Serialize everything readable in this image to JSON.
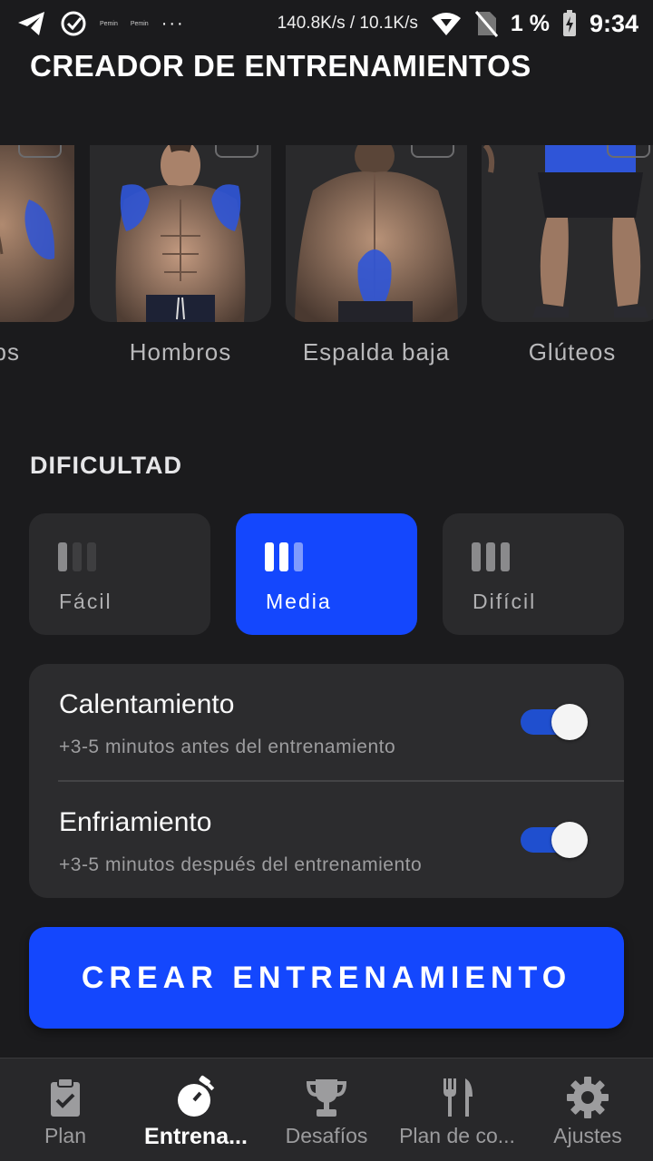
{
  "status_bar": {
    "small_labels": [
      "Pemin",
      "Pemin"
    ],
    "dots": "···",
    "network_speed": "140.8K/s / 10.1K/s",
    "battery": "1 %",
    "time": "9:34"
  },
  "title": "CREADOR DE ENTRENAMIENTOS",
  "muscles": [
    {
      "label": "ps"
    },
    {
      "label": "Hombros"
    },
    {
      "label": "Espalda baja"
    },
    {
      "label": "Glúteos"
    }
  ],
  "difficulty": {
    "title": "DIFICULTAD",
    "options": [
      {
        "label": "Fácil",
        "level": 1,
        "selected": false
      },
      {
        "label": "Media",
        "level": 2,
        "selected": true
      },
      {
        "label": "Difícil",
        "level": 3,
        "selected": false
      }
    ]
  },
  "options": [
    {
      "title": "Calentamiento",
      "subtitle": "+3-5 minutos antes del entrenamiento",
      "enabled": true
    },
    {
      "title": "Enfriamiento",
      "subtitle": "+3-5 minutos después del entrenamiento",
      "enabled": true
    }
  ],
  "create_button": "CREAR ENTRENAMIENTO",
  "nav": {
    "items": [
      {
        "label": "Plan",
        "icon": "clipboard-icon",
        "active": false
      },
      {
        "label": "Entrena...",
        "icon": "stopwatch-icon",
        "active": true
      },
      {
        "label": "Desafíos",
        "icon": "trophy-icon",
        "active": false
      },
      {
        "label": "Plan de co...",
        "icon": "fork-knife-icon",
        "active": false
      },
      {
        "label": "Ajustes",
        "icon": "gear-icon",
        "active": false
      }
    ]
  },
  "colors": {
    "accent": "#1447fd",
    "background": "#1b1b1d",
    "card": "#2a2a2c"
  }
}
